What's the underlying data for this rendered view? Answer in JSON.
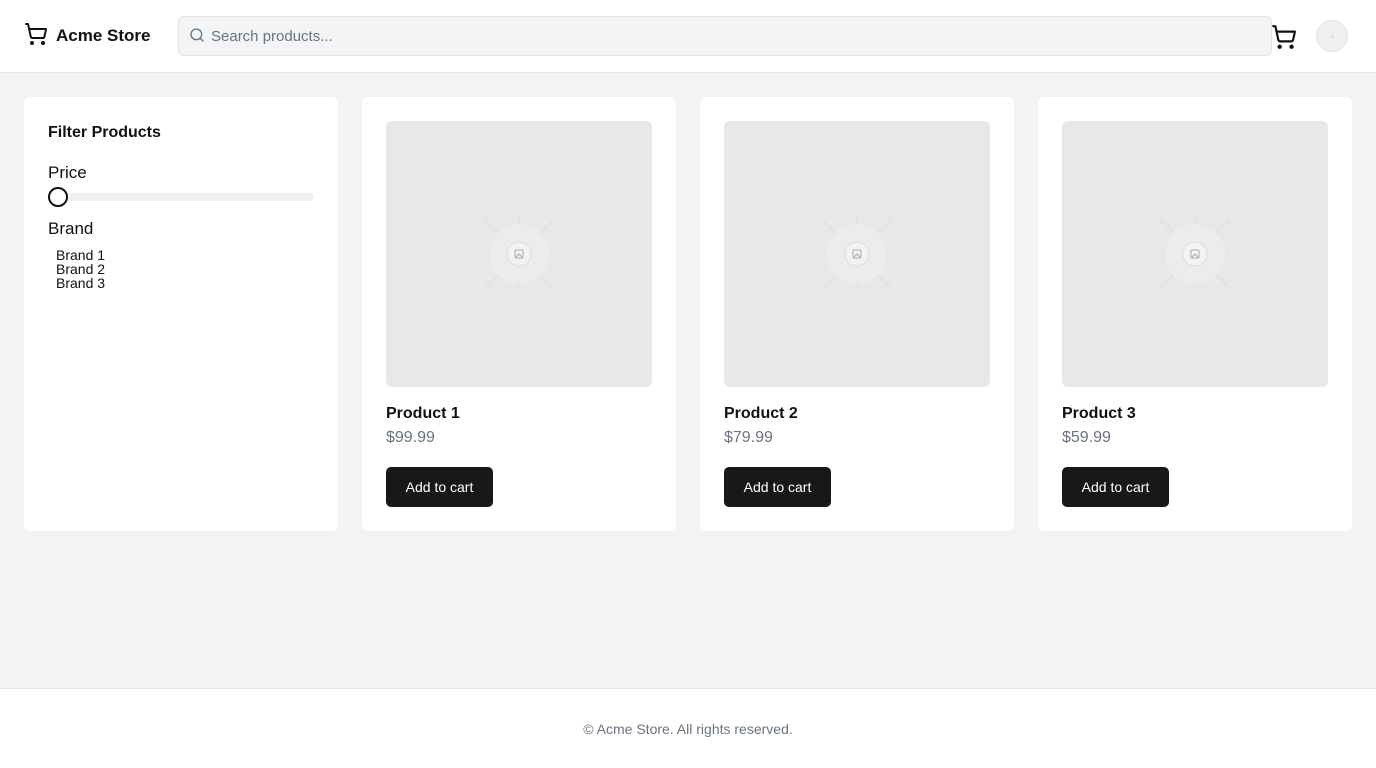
{
  "header": {
    "brand_name": "Acme Store",
    "brand_icon": "shopping-cart-icon",
    "search": {
      "placeholder": "Search products...",
      "value": ""
    },
    "cart_icon": "shopping-cart-icon",
    "avatar_icon": "user-avatar"
  },
  "sidebar": {
    "title": "Filter Products",
    "price_label": "Price",
    "price_slider_level": 0,
    "brand_label": "Brand",
    "brands": [
      {
        "label": "Brand 1"
      },
      {
        "label": "Brand 2"
      },
      {
        "label": "Brand 3"
      }
    ]
  },
  "products": [
    {
      "name": "Product 1",
      "price": "$99.99",
      "button": "Add to cart",
      "image_icon": "image-placeholder-icon"
    },
    {
      "name": "Product 2",
      "price": "$79.99",
      "button": "Add to cart",
      "image_icon": "image-placeholder-icon"
    },
    {
      "name": "Product 3",
      "price": "$59.99",
      "button": "Add to cart",
      "image_icon": "image-placeholder-icon"
    }
  ],
  "footer": {
    "text": "© Acme Store. All rights reserved."
  },
  "colors": {
    "background": "#f2f3f5",
    "surface": "#ffffff",
    "primary_button": "#18181b",
    "muted_text": "#6b7280",
    "placeholder_image": "#e8e8e9"
  }
}
